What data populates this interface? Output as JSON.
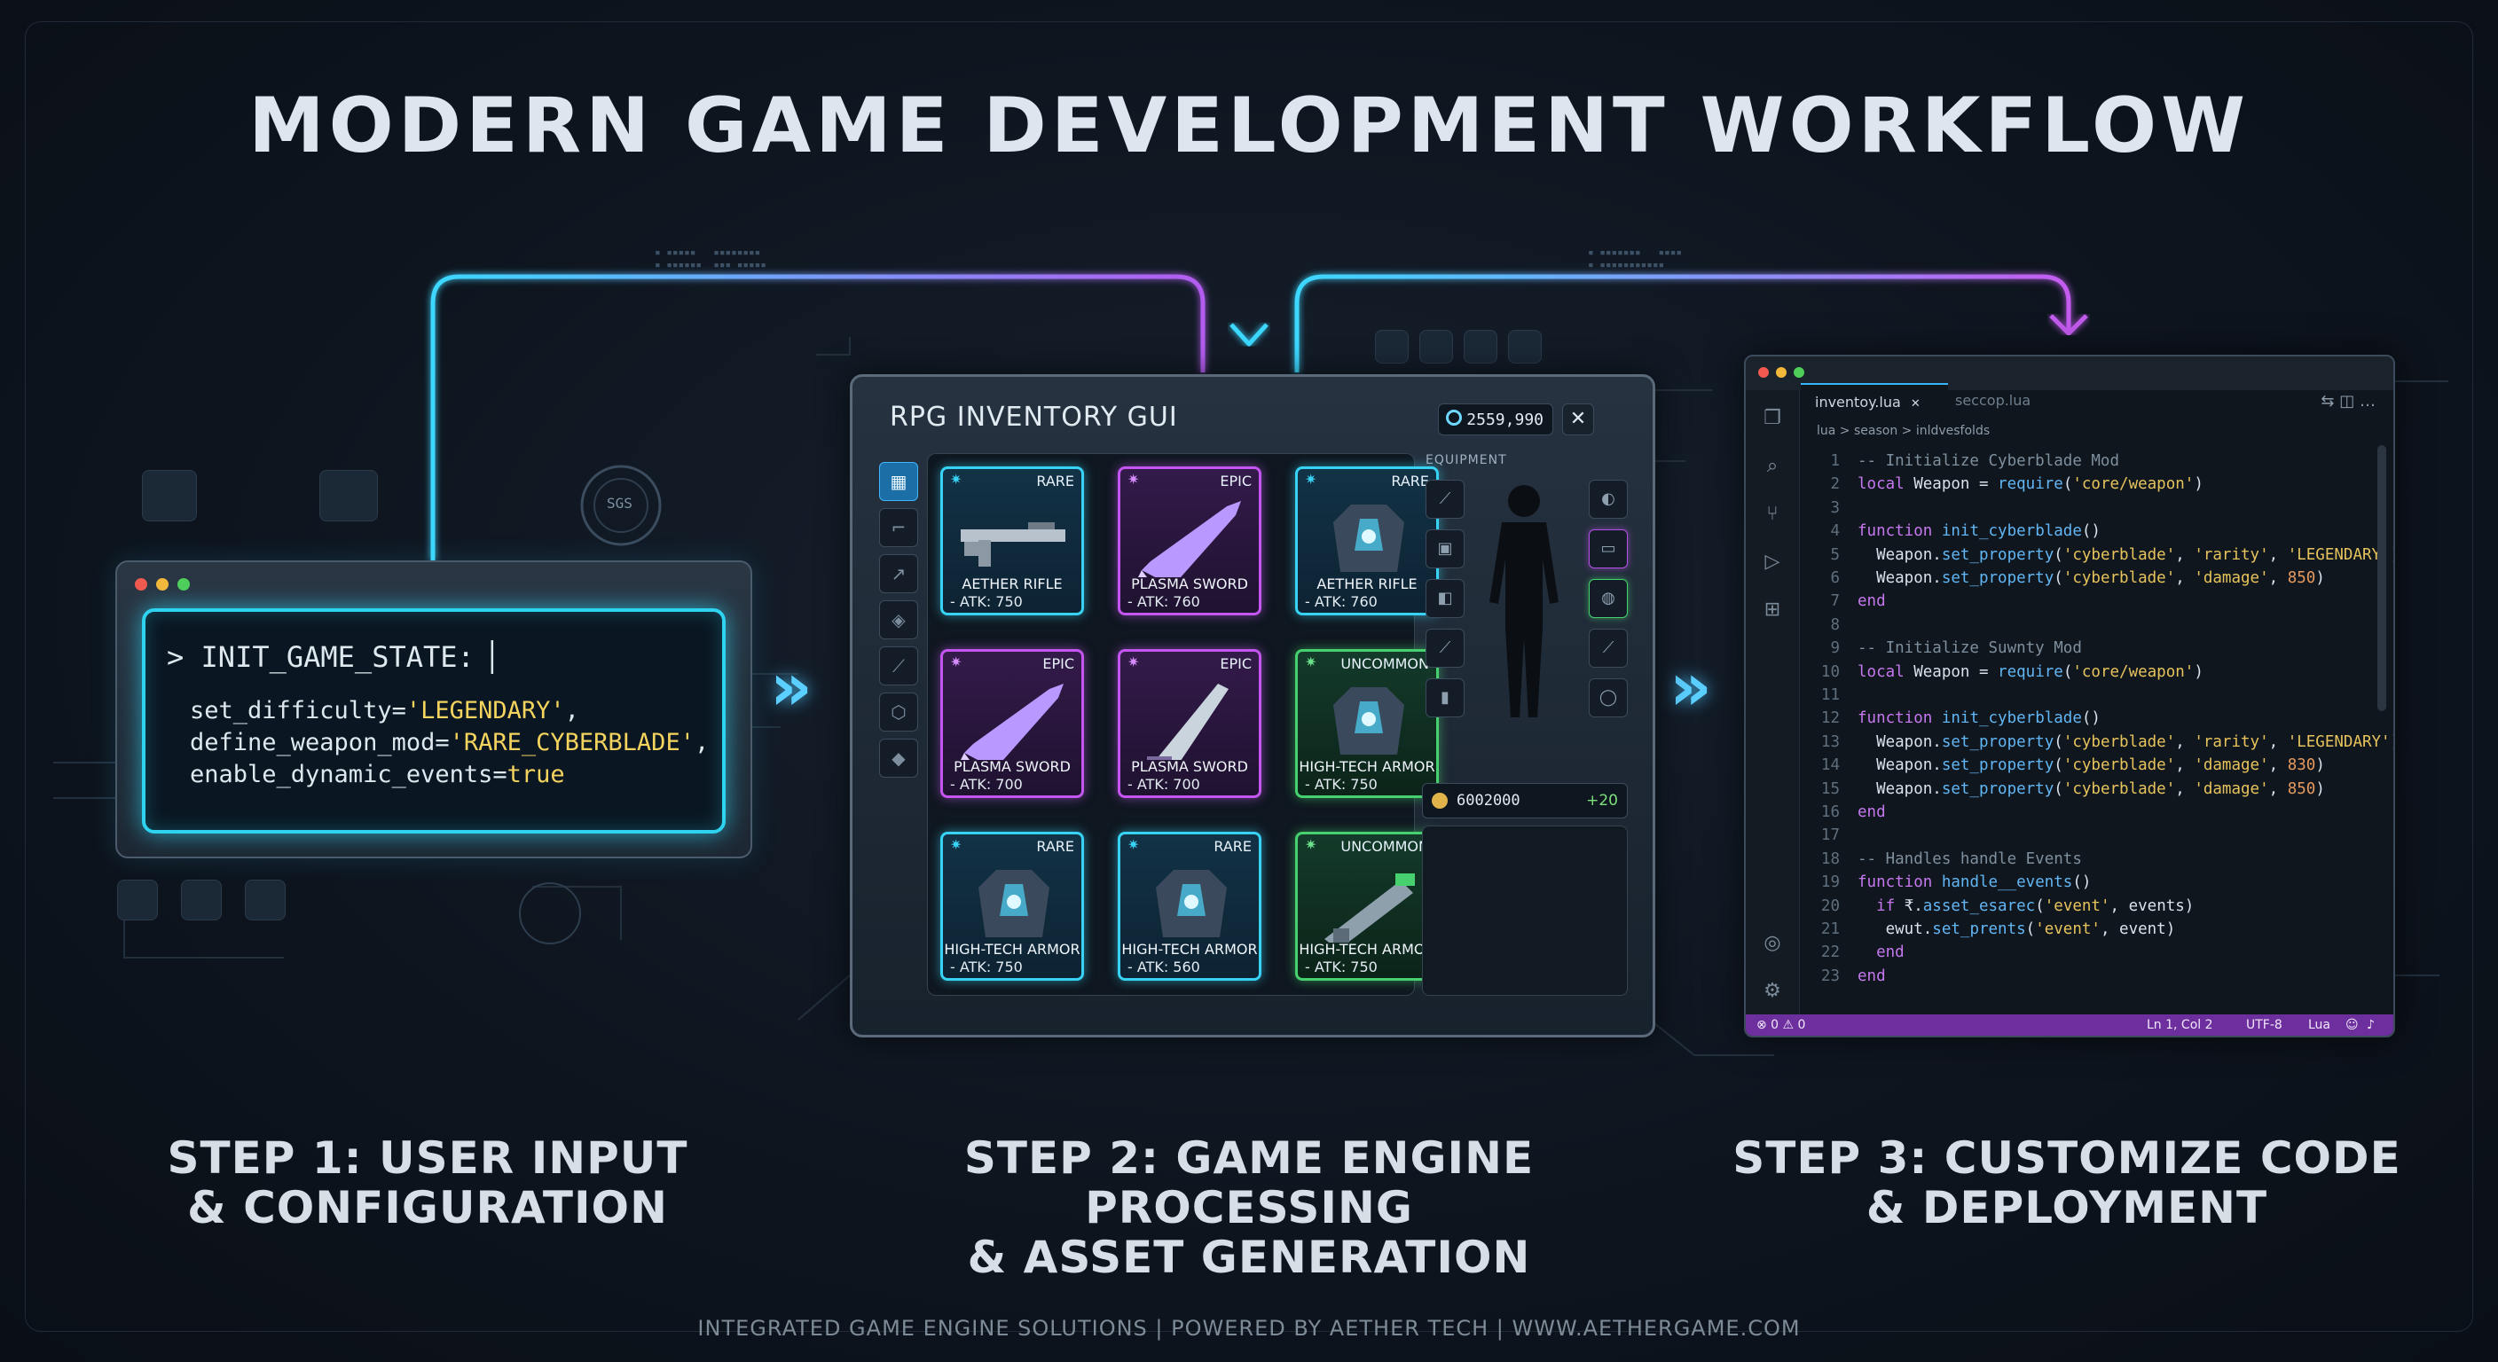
{
  "title": "MODERN GAME DEVELOPMENT WORKFLOW",
  "step1": {
    "terminal": {
      "prompt": "> INIT_GAME_STATE: ▏",
      "lines": [
        {
          "key": "set_difficulty=",
          "value": "'LEGENDARY'",
          "suffix": ","
        },
        {
          "key": "define_weapon_mod=",
          "value": "'RARE_CYBERBLADE'",
          "suffix": ","
        },
        {
          "key": "enable_dynamic_events=",
          "value": "true",
          "suffix": ""
        }
      ]
    },
    "label_line1": "STEP 1: USER INPUT",
    "label_line2": "& CONFIGURATION"
  },
  "step2": {
    "panel_title": "RPG INVENTORY GUI",
    "currency": "2559,990",
    "close_label": "✕",
    "equipment_label": "EQUIPMENT",
    "gold_value": "6002000",
    "gold_bonus": "+20",
    "items": [
      {
        "rarity": "RARE",
        "name": "AETHER RIFLE",
        "atk": "- ATK: 750",
        "kind": "rare",
        "icon": "rifle-icon"
      },
      {
        "rarity": "EPIC",
        "name": "PLASMA SWORD",
        "atk": "- ATK: 760",
        "kind": "epic",
        "icon": "sword-icon"
      },
      {
        "rarity": "RARE",
        "name": "AETHER RIFLE",
        "atk": "- ATK: 760",
        "kind": "rare",
        "icon": "armor-icon"
      },
      {
        "rarity": "EPIC",
        "name": "PLASMA SWORD",
        "atk": "- ATK: 700",
        "kind": "epic",
        "icon": "sword-icon"
      },
      {
        "rarity": "EPIC",
        "name": "PLASMA SWORD",
        "atk": "- ATK: 700",
        "kind": "epic",
        "icon": "blade-icon"
      },
      {
        "rarity": "UNCOMMON",
        "name": "HIGH-TECH ARMOR",
        "atk": "- ATK: 750",
        "kind": "uncommon",
        "icon": "armor-icon"
      },
      {
        "rarity": "RARE",
        "name": "HIGH-TECH ARMOR",
        "atk": "- ATK: 750",
        "kind": "rare",
        "icon": "armor-icon"
      },
      {
        "rarity": "RARE",
        "name": "HIGH-TECH ARMOR",
        "atk": "- ATK: 560",
        "kind": "rare",
        "icon": "armor-icon"
      },
      {
        "rarity": "UNCOMMON",
        "name": "HIGH-TECH ARMOR",
        "atk": "- ATK: 750",
        "kind": "uncommon",
        "icon": "cannon-icon"
      }
    ],
    "label_line1": "STEP 2: GAME ENGINE PROCESSING",
    "label_line2": "& ASSET GENERATION"
  },
  "step3": {
    "tabs": [
      "inventoy.lua",
      "seccop.lua"
    ],
    "tab_close": "✕",
    "breadcrumb": "lua  >  season  >  inldvesfolds",
    "code": [
      {
        "n": "1",
        "parts": [
          [
            "cm",
            "-- Initialize Cyberblade Mod"
          ]
        ]
      },
      {
        "n": "2",
        "parts": [
          [
            "kw",
            "local"
          ],
          [
            "t",
            " Weapon = "
          ],
          [
            "fn",
            "require"
          ],
          [
            "t",
            "("
          ],
          [
            "s",
            "'core/weapon'"
          ],
          [
            "t",
            ")"
          ]
        ]
      },
      {
        "n": "3",
        "parts": []
      },
      {
        "n": "4",
        "parts": [
          [
            "kw",
            "function"
          ],
          [
            "t",
            " "
          ],
          [
            "fn",
            "init_cyberblade"
          ],
          [
            "t",
            "()"
          ]
        ]
      },
      {
        "n": "5",
        "parts": [
          [
            "t",
            "  Weapon."
          ],
          [
            "fn",
            "set_property"
          ],
          [
            "t",
            "("
          ],
          [
            "s",
            "'cyberblade'"
          ],
          [
            "t",
            ", "
          ],
          [
            "s",
            "'rarity'"
          ],
          [
            "t",
            ", "
          ],
          [
            "s",
            "'LEGENDARY'"
          ],
          [
            "t",
            ")"
          ]
        ]
      },
      {
        "n": "6",
        "parts": [
          [
            "t",
            "  Weapon."
          ],
          [
            "fn",
            "set_property"
          ],
          [
            "t",
            "("
          ],
          [
            "s",
            "'cyberblade'"
          ],
          [
            "t",
            ", "
          ],
          [
            "s",
            "'damage'"
          ],
          [
            "t",
            ", "
          ],
          [
            "n",
            "850"
          ],
          [
            "t",
            ")"
          ]
        ]
      },
      {
        "n": "7",
        "parts": [
          [
            "kw",
            "end"
          ]
        ]
      },
      {
        "n": "8",
        "parts": []
      },
      {
        "n": "9",
        "parts": [
          [
            "cm",
            "-- Initialize Suwnty Mod"
          ]
        ]
      },
      {
        "n": "10",
        "parts": [
          [
            "kw",
            "local"
          ],
          [
            "t",
            " Weapon = "
          ],
          [
            "fn",
            "require"
          ],
          [
            "t",
            "("
          ],
          [
            "s",
            "'core/weapon'"
          ],
          [
            "t",
            ")"
          ]
        ]
      },
      {
        "n": "11",
        "parts": []
      },
      {
        "n": "12",
        "parts": [
          [
            "kw",
            "function"
          ],
          [
            "t",
            " "
          ],
          [
            "fn",
            "init_cyberblade"
          ],
          [
            "t",
            "()"
          ]
        ]
      },
      {
        "n": "13",
        "parts": [
          [
            "t",
            "  Weapon."
          ],
          [
            "fn",
            "set_property"
          ],
          [
            "t",
            "("
          ],
          [
            "s",
            "'cyberblade'"
          ],
          [
            "t",
            ", "
          ],
          [
            "s",
            "'rarity'"
          ],
          [
            "t",
            ", "
          ],
          [
            "s",
            "'LEGENDARY'"
          ],
          [
            "t",
            ")"
          ]
        ]
      },
      {
        "n": "14",
        "parts": [
          [
            "t",
            "  Weapon."
          ],
          [
            "fn",
            "set_property"
          ],
          [
            "t",
            "("
          ],
          [
            "s",
            "'cyberblade'"
          ],
          [
            "t",
            ", "
          ],
          [
            "s",
            "'damage'"
          ],
          [
            "t",
            ", "
          ],
          [
            "n",
            "830"
          ],
          [
            "t",
            ")"
          ]
        ]
      },
      {
        "n": "15",
        "parts": [
          [
            "t",
            "  Weapon."
          ],
          [
            "fn",
            "set_property"
          ],
          [
            "t",
            "("
          ],
          [
            "s",
            "'cyberblade'"
          ],
          [
            "t",
            ", "
          ],
          [
            "s",
            "'damage'"
          ],
          [
            "t",
            ", "
          ],
          [
            "n",
            "850"
          ],
          [
            "t",
            ")"
          ]
        ]
      },
      {
        "n": "16",
        "parts": [
          [
            "kw",
            "end"
          ]
        ]
      },
      {
        "n": "17",
        "parts": []
      },
      {
        "n": "18",
        "parts": [
          [
            "cm",
            "-- Handles handle Events"
          ]
        ]
      },
      {
        "n": "19",
        "parts": [
          [
            "kw",
            "function"
          ],
          [
            "t",
            " "
          ],
          [
            "fn",
            "handle__events"
          ],
          [
            "t",
            "()"
          ]
        ]
      },
      {
        "n": "20",
        "parts": [
          [
            "t",
            "  "
          ],
          [
            "kw",
            "if"
          ],
          [
            "t",
            " ₹."
          ],
          [
            "fn",
            "asset_esarec"
          ],
          [
            "t",
            "("
          ],
          [
            "s",
            "'event'"
          ],
          [
            "t",
            ", events)"
          ]
        ]
      },
      {
        "n": "21",
        "parts": [
          [
            "t",
            "   ewut."
          ],
          [
            "fn",
            "set_prents"
          ],
          [
            "t",
            "("
          ],
          [
            "s",
            "'event'"
          ],
          [
            "t",
            ", event)"
          ]
        ]
      },
      {
        "n": "22",
        "parts": [
          [
            "t",
            "  "
          ],
          [
            "kw",
            "end"
          ]
        ]
      },
      {
        "n": "23",
        "parts": [
          [
            "kw",
            "end"
          ]
        ]
      }
    ],
    "status_left": "⊗ 0 ⚠ 0",
    "status_pos": "Ln 1, Col 2",
    "status_enc": "UTF-8",
    "status_lang": "Lua",
    "label_line1": "STEP 3: CUSTOMIZE CODE",
    "label_line2": "& DEPLOYMENT"
  },
  "hud_labels": [
    "SGS",
    "SGS"
  ],
  "footer": "INTEGRATED GAME ENGINE SOLUTIONS  |  POWERED BY AETHER TECH  |  WWW.AETHERGAME.COM",
  "colors": {
    "cyan": "#2ed3ef",
    "purple": "#c455f0",
    "green": "#46d16e",
    "status_bar": "#6d2f9e"
  }
}
